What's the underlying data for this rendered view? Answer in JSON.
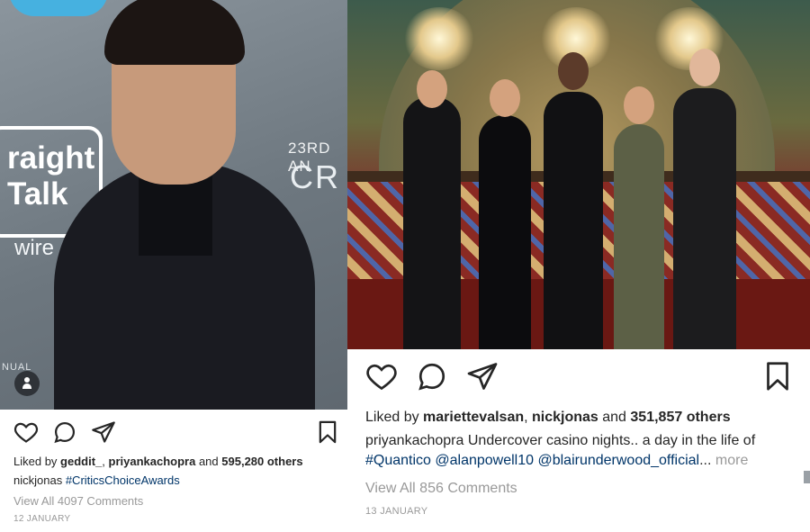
{
  "left_post": {
    "photo": {
      "sponsor_logo_text": "raight Talk",
      "sponsor_sub_text": "wire",
      "event_text_top": "23RD AN",
      "event_text_big": "CR",
      "event_text_bottom": "NUAL"
    },
    "likes": {
      "prefix": "Liked by ",
      "user1": "geddit_",
      "separator": ", ",
      "user2": "priyankachopra",
      "mid": " and ",
      "count": "595,280 others"
    },
    "caption": {
      "user": "nickjonas",
      "text": "#CriticsChoiceAwards"
    },
    "comments": "View All 4097 Comments",
    "date": "12 JANUARY"
  },
  "right_post": {
    "likes": {
      "prefix": "Liked by ",
      "user1": "mariettevalsan",
      "separator": ", ",
      "user2": "nickjonas",
      "mid": " and ",
      "count": "351,857 others"
    },
    "caption": {
      "user": "priyankachopra",
      "text": "Undercover casino nights.. a day in the life of",
      "line2_tags": "#Quantico @alanpowell10 @blairunderwood_official",
      "line2_ellipsis": "...",
      "more": "more"
    },
    "comments": "View All 856 Comments",
    "date": "13 JANUARY"
  },
  "icons": {
    "like": "heart-icon",
    "comment": "comment-icon",
    "share": "send-icon",
    "save": "bookmark-icon",
    "tag": "user-tag-icon"
  },
  "colors": {
    "text": "#262626",
    "muted": "#999999",
    "link": "#003569"
  }
}
